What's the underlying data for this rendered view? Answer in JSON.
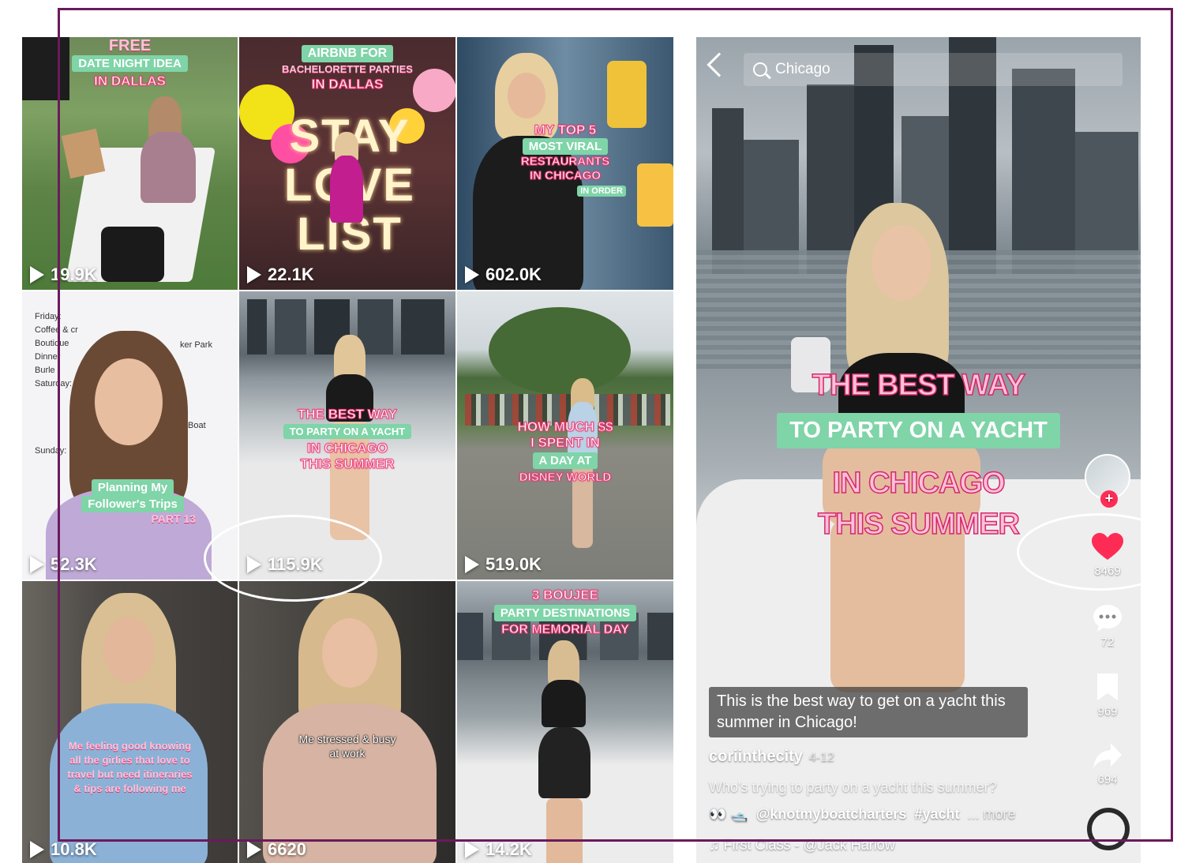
{
  "search": {
    "query": "Chicago"
  },
  "grid": [
    {
      "views": "19.9K",
      "lines": [
        "FREE",
        "DATE NIGHT IDEA",
        "IN DALLAS"
      ]
    },
    {
      "views": "22.1K",
      "lines": [
        "AIRBNB FOR",
        "BACHELORETTE PARTIES",
        "IN DALLAS"
      ],
      "sign": "STAY LOVE LIST"
    },
    {
      "views": "602.0K",
      "lines": [
        "MY TOP 5",
        "MOST VIRAL",
        "RESTAURANTS",
        "IN CHICAGO",
        "IN ORDER"
      ]
    },
    {
      "views": "52.3K",
      "lines": [
        "Planning My",
        "Follower's Trips",
        "PART 13"
      ],
      "notes": [
        "Friday:",
        "Coffee & cr",
        "Boutique",
        "Dinner",
        "Burle",
        "Saturday:",
        "Sunday:",
        "ker Park",
        "Boat"
      ]
    },
    {
      "views": "115.9K",
      "lines": [
        "THE BEST WAY",
        "TO PARTY ON A YACHT",
        "IN CHICAGO",
        "THIS SUMMER"
      ]
    },
    {
      "views": "519.0K",
      "lines": [
        "HOW MUCH $$",
        "I SPENT IN",
        "A DAY AT",
        "DISNEY WORLD"
      ]
    },
    {
      "views": "10.8K",
      "lines": [
        "Me feeling good knowing",
        "all the girlies that love to",
        "travel but need itineraries",
        "& tips are following me"
      ]
    },
    {
      "views": "6620",
      "lines": [
        "Me stressed & busy",
        "at work"
      ]
    },
    {
      "views": "14.2K",
      "lines": [
        "3 BOUJEE",
        "PARTY DESTINATIONS",
        "FOR MEMORIAL DAY"
      ]
    }
  ],
  "player": {
    "overlay": [
      "THE BEST WAY",
      "TO PARTY ON A YACHT",
      "IN CHICAGO",
      "THIS SUMMER"
    ],
    "likes": "8469",
    "comments": "72",
    "saves": "969",
    "shares": "694",
    "description": "This is the best way to get on a yacht this summer in Chicago!",
    "username": "coriinthecity",
    "date": "4-12",
    "caption": "Who's trying to party on a yacht this summer?",
    "emoji": "👀 🛥️",
    "mention": "@knotmyboatcharters",
    "hashtag": "#yacht",
    "more": "... more",
    "music": "First Class - @Jack Harlow"
  },
  "colors": {
    "accent_green": "#7fd4a8",
    "like_red": "#fe2c55",
    "frame_purple": "#6b1a5c"
  }
}
